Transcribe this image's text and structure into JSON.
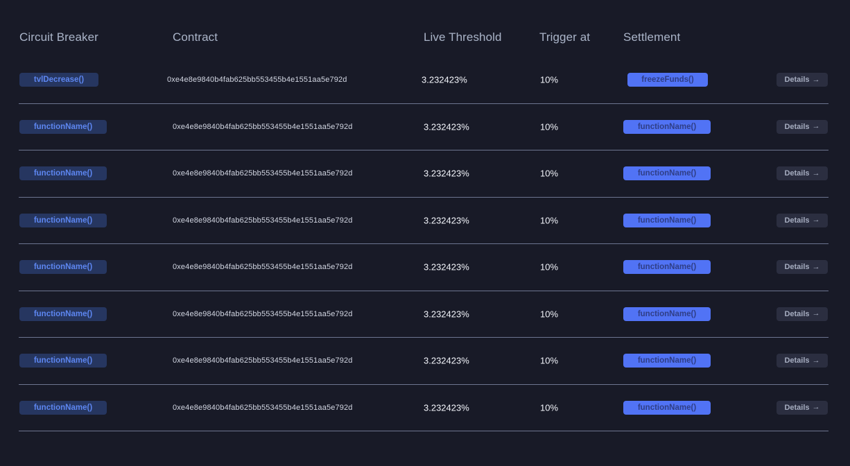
{
  "headers": {
    "circuit_breaker": "Circuit Breaker",
    "contract": "Contract",
    "live_threshold": "Live Threshold",
    "trigger_at": "Trigger at",
    "settlement": "Settlement"
  },
  "rows": [
    {
      "breaker": "tvlDecrease()",
      "contract": "0xe4e8e9840b4fab625bb553455b4e1551aa5e792d",
      "threshold": "3.232423%",
      "trigger": "10%",
      "settlement": "freezeFunds()",
      "details": "Details"
    },
    {
      "breaker": "functionName()",
      "contract": "0xe4e8e9840b4fab625bb553455b4e1551aa5e792d",
      "threshold": "3.232423%",
      "trigger": "10%",
      "settlement": "functionName()",
      "details": "Details"
    },
    {
      "breaker": "functionName()",
      "contract": "0xe4e8e9840b4fab625bb553455b4e1551aa5e792d",
      "threshold": "3.232423%",
      "trigger": "10%",
      "settlement": "functionName()",
      "details": "Details"
    },
    {
      "breaker": "functionName()",
      "contract": "0xe4e8e9840b4fab625bb553455b4e1551aa5e792d",
      "threshold": "3.232423%",
      "trigger": "10%",
      "settlement": "functionName()",
      "details": "Details"
    },
    {
      "breaker": "functionName()",
      "contract": "0xe4e8e9840b4fab625bb553455b4e1551aa5e792d",
      "threshold": "3.232423%",
      "trigger": "10%",
      "settlement": "functionName()",
      "details": "Details"
    },
    {
      "breaker": "functionName()",
      "contract": "0xe4e8e9840b4fab625bb553455b4e1551aa5e792d",
      "threshold": "3.232423%",
      "trigger": "10%",
      "settlement": "functionName()",
      "details": "Details"
    },
    {
      "breaker": "functionName()",
      "contract": "0xe4e8e9840b4fab625bb553455b4e1551aa5e792d",
      "threshold": "3.232423%",
      "trigger": "10%",
      "settlement": "functionName()",
      "details": "Details"
    },
    {
      "breaker": "functionName()",
      "contract": "0xe4e8e9840b4fab625bb553455b4e1551aa5e792d",
      "threshold": "3.232423%",
      "trigger": "10%",
      "settlement": "functionName()",
      "details": "Details"
    }
  ],
  "icons": {
    "details_arrow": "arrow-right-icon"
  },
  "colors": {
    "background": "#181a27",
    "breaker_pill": "#263660",
    "breaker_text": "#5d86f0",
    "settlement_pill": "#5173f5",
    "settlement_text": "#2f3e86",
    "details_button": "#2b2e40",
    "divider": "#6d7590"
  }
}
